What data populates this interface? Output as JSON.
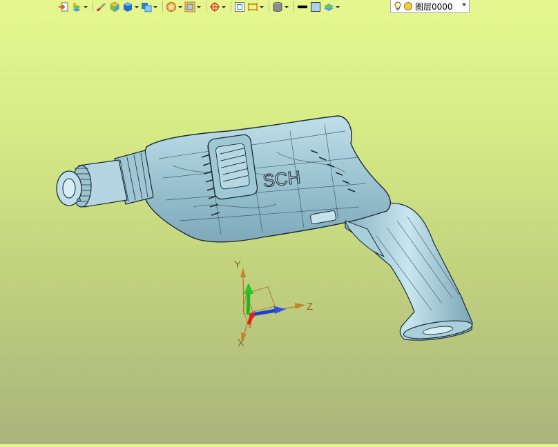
{
  "toolbar": {
    "items": [
      {
        "name": "import-icon",
        "has_dropdown": false
      },
      {
        "name": "layer-manager-icon",
        "has_dropdown": true
      },
      {
        "name": "paint-brush-icon",
        "has_dropdown": false
      },
      {
        "name": "cube-color-icon",
        "has_dropdown": false
      },
      {
        "name": "solid-cube-icon",
        "has_dropdown": true
      },
      {
        "name": "view-cube-icon",
        "has_dropdown": true
      },
      {
        "name": "render-mode-icon",
        "has_dropdown": true
      },
      {
        "name": "display-filter-icon",
        "has_dropdown": true
      },
      {
        "name": "snap-target-icon",
        "has_dropdown": true
      },
      {
        "name": "frame-icon",
        "has_dropdown": false
      },
      {
        "name": "dimension-icon",
        "has_dropdown": true
      },
      {
        "name": "cylinder-icon",
        "has_dropdown": true
      },
      {
        "name": "line-color-swatch-icon",
        "has_dropdown": false
      },
      {
        "name": "fill-color-swatch-icon",
        "has_dropdown": false
      },
      {
        "name": "layer-stack-icon",
        "has_dropdown": true
      }
    ],
    "layer_select": {
      "value": "图层0000",
      "icons": [
        "light-bulb-icon",
        "sun-icon"
      ]
    }
  },
  "viewport": {
    "model": "Bosch hammer drill housing (transparent shaded)",
    "brand_text": "SCH",
    "triad": {
      "x_label": "X",
      "y_label": "Y",
      "z_label": "Z"
    },
    "colors": {
      "background_top": "#e6f78e",
      "background_bottom": "#aab37c",
      "model_fill": "#9fc7d4",
      "model_edge": "#1c2a35",
      "axis_x": "#e0231b",
      "axis_y": "#20b61f",
      "axis_z": "#1d3fd3",
      "axis_label": "#8a6a26"
    }
  }
}
